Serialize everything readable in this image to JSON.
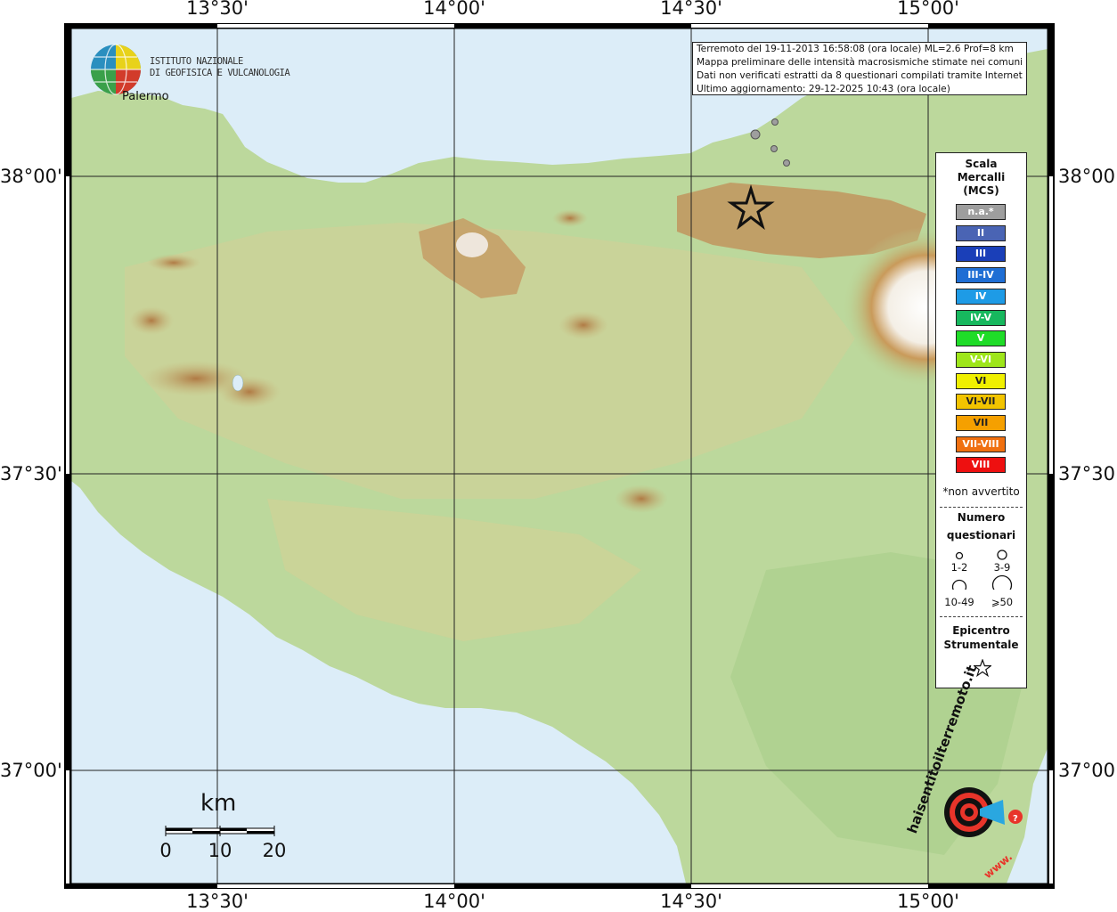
{
  "map": {
    "top_longitudes": [
      "13°30'",
      "14°00'",
      "14°30'",
      "15°00'"
    ],
    "bottom_longitudes": [
      "13°30'",
      "14°00'",
      "14°30'",
      "15°00'"
    ],
    "left_latitudes": [
      "38°00'",
      "37°30'",
      "37°00'"
    ],
    "right_latitudes": [
      "38°00'",
      "37°30'",
      "37°00'"
    ],
    "place_label": "Palermo",
    "colors": {
      "sea": "#dcedf8",
      "lowland": "#b8d79a",
      "hill": "#d4cc8f",
      "mountain": "#b8824a",
      "peak": "#ffffff",
      "grid": "#222222"
    }
  },
  "agency": {
    "line1": "ISTITUTO NAZIONALE",
    "line2": "DI GEOFISICA E VULCANOLOGIA"
  },
  "info": {
    "line1": "Terremoto del 19-11-2013 16:58:08 (ora locale) ML=2.6 Prof=8 km",
    "line2": "Mappa preliminare delle intensità macrosismiche stimate nei comuni",
    "line3": "Dati non verificati estratti da 8 questionari compilati tramite Internet.",
    "line4": "Ultimo aggiornamento: 29-12-2025 10:43 (ora locale)"
  },
  "legend": {
    "title_line1": "Scala",
    "title_line2": "Mercalli",
    "title_line3": "(MCS)",
    "items": [
      {
        "label": "n.a.*",
        "color": "#9e9e9e"
      },
      {
        "label": "II",
        "color": "#4a64b4"
      },
      {
        "label": "III",
        "color": "#1a3fb8"
      },
      {
        "label": "III-IV",
        "color": "#1f6ed4"
      },
      {
        "label": "IV",
        "color": "#1e9be6"
      },
      {
        "label": "IV-V",
        "color": "#17b85e"
      },
      {
        "label": "V",
        "color": "#1fdc28"
      },
      {
        "label": "V-VI",
        "color": "#9ee61a"
      },
      {
        "label": "VI",
        "color": "#f0f000"
      },
      {
        "label": "VI-VII",
        "color": "#f2c400"
      },
      {
        "label": "VII",
        "color": "#f5a000"
      },
      {
        "label": "VII-VIII",
        "color": "#f07010"
      },
      {
        "label": "VIII",
        "color": "#ee1010"
      }
    ],
    "note": "*non avvertito",
    "count_title_line1": "Numero",
    "count_title_line2": "questionari",
    "counts": [
      "1-2",
      "3-9",
      "10-49",
      "⩾50"
    ],
    "epicenter_line1": "Epicentro",
    "epicenter_line2": "Strumentale"
  },
  "scalebar": {
    "unit": "km",
    "ticks": [
      "0",
      "10",
      "20"
    ]
  },
  "hsh_logo": {
    "text": "haisentitoilterremoto.it",
    "www": "www."
  }
}
